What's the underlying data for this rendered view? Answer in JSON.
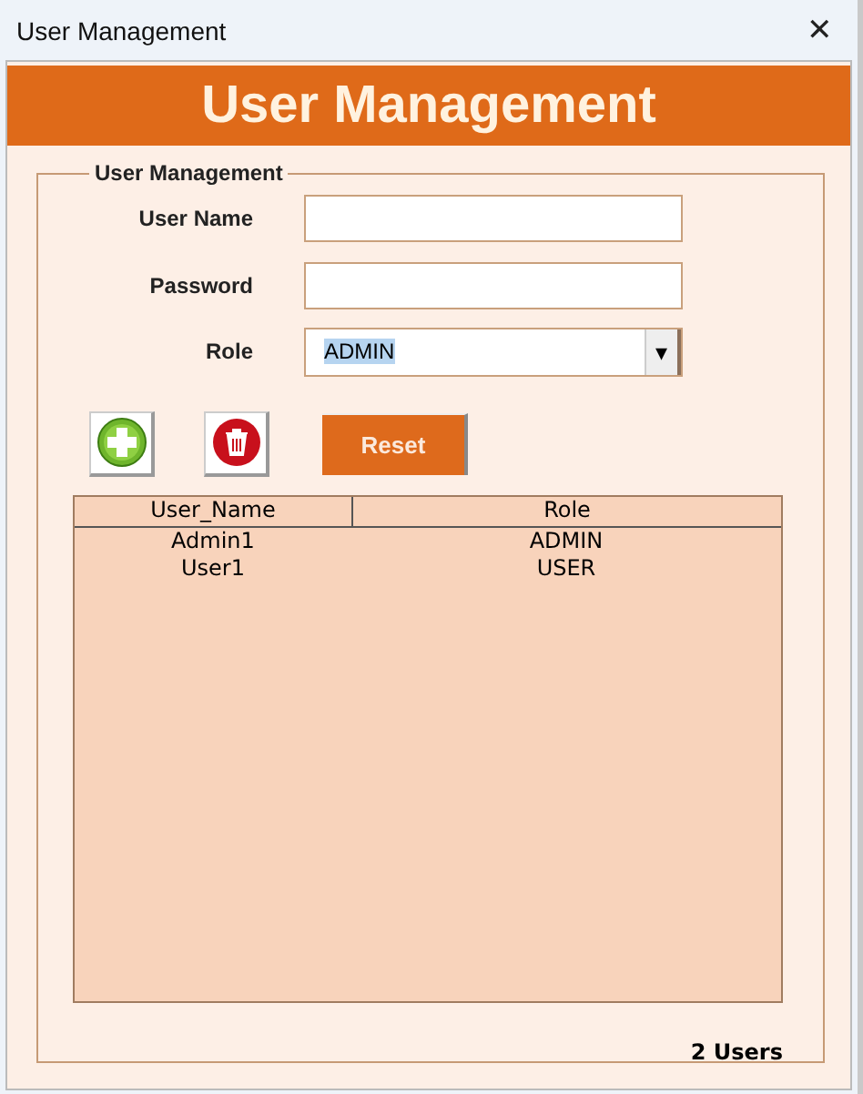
{
  "window": {
    "title": "User Management",
    "close": "✕"
  },
  "header": {
    "title": "User Management"
  },
  "group": {
    "legend": "User Management",
    "fields": [
      {
        "kind": "text",
        "label": "User Name"
      },
      {
        "kind": "password",
        "label": "Password"
      },
      {
        "kind": "dropdown",
        "label": "Role",
        "value": "ADMIN",
        "caret": "▾"
      }
    ],
    "buttons": [
      {
        "kind": "add"
      },
      {
        "kind": "delete"
      },
      {
        "kind": "text",
        "label": "Reset"
      }
    ],
    "table": {
      "columns": [
        "User_Name",
        "Role"
      ],
      "rows": [
        [
          "Admin1",
          "ADMIN"
        ],
        [
          "User1",
          "USER"
        ]
      ]
    },
    "count": "2 Users"
  }
}
